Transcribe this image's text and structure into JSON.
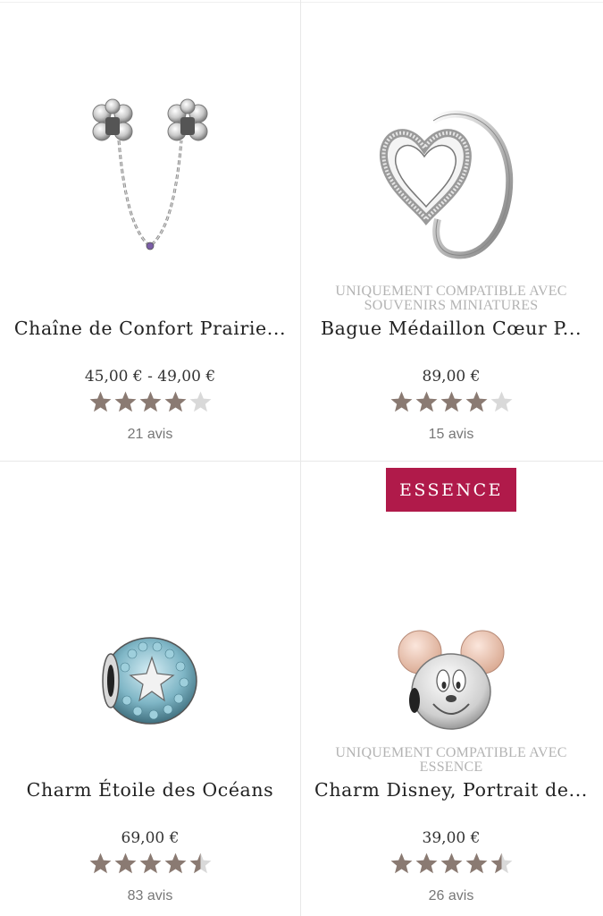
{
  "products": [
    {
      "name": "Chaîne de Confort Prairie...",
      "price": "45,00 € - 49,00 €",
      "rating": 4,
      "reviews": "21 avis",
      "image": "silver-safety-chain-with-flower-clips"
    },
    {
      "compat_line1": "UNIQUEMENT COMPATIBLE AVEC",
      "compat_line2": "SOUVENIRS MINIATURES",
      "name": "Bague Médaillon Cœur P...",
      "price": "89,00 €",
      "rating": 4,
      "reviews": "15 avis",
      "image": "heart-locket-ring"
    },
    {
      "name": "Charm Étoile des Océans",
      "price": "69,00 €",
      "rating": 4.5,
      "reviews": "83 avis",
      "image": "blue-pave-starfish-charm"
    },
    {
      "badge": "ESSENCE",
      "compat_line1": "UNIQUEMENT COMPATIBLE AVEC",
      "compat_line2": "ESSENCE",
      "name": "Charm Disney, Portrait de...",
      "price": "39,00 €",
      "rating": 4.5,
      "reviews": "26 avis",
      "image": "mickey-mouse-portrait-charm"
    }
  ],
  "colors": {
    "star_filled": "#8a7a72",
    "star_empty": "#d9d9d9",
    "badge_bg": "#b01a4a",
    "divider": "#e8e8e8"
  }
}
